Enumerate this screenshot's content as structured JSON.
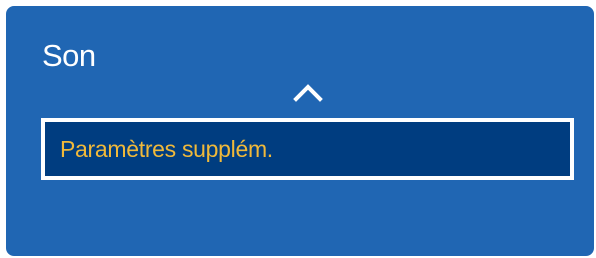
{
  "panel": {
    "title": "Son"
  },
  "navigation": {
    "up_icon": "chevron-up-icon"
  },
  "menu": {
    "items": [
      {
        "label": "Paramètres supplém.",
        "selected": true
      }
    ]
  },
  "colors": {
    "panel_background": "#2066b3",
    "selected_background": "#003d80",
    "selected_border": "#ffffff",
    "selected_text": "#f0b93a",
    "title_text": "#ffffff"
  }
}
